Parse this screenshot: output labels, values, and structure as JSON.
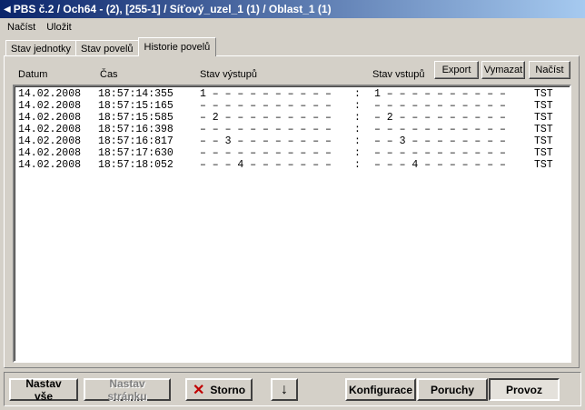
{
  "window": {
    "title": "PBS č.2 / Och64 - (2), [255-1] / Síťový_uzel_1 (1) / Oblast_1 (1)"
  },
  "menu": [
    "Načíst",
    "Uložit"
  ],
  "tabs": [
    "Stav jednotky",
    "Stav povelů",
    "Historie povelů"
  ],
  "active_tab": 2,
  "columns": {
    "date": "Datum",
    "time": "Čas",
    "outputs": "Stav výstupů",
    "inputs": "Stav vstupů"
  },
  "top_buttons": {
    "export": "Export",
    "clear": "Vymazat",
    "load": "Načíst"
  },
  "rows": [
    {
      "date": "14.02.2008",
      "time": "18:57:14:355",
      "outputs": "1 – – – – – – – – – –",
      "sep": ":",
      "inputs": "1 – – – – – – – – – –",
      "src": "TST"
    },
    {
      "date": "14.02.2008",
      "time": "18:57:15:165",
      "outputs": "– – – – – – – – – – –",
      "sep": ":",
      "inputs": "– – – – – – – – – – –",
      "src": "TST"
    },
    {
      "date": "14.02.2008",
      "time": "18:57:15:585",
      "outputs": "– 2 – – – – – – – – –",
      "sep": ":",
      "inputs": "– 2 – – – – – – – – –",
      "src": "TST"
    },
    {
      "date": "14.02.2008",
      "time": "18:57:16:398",
      "outputs": "– – – – – – – – – – –",
      "sep": ":",
      "inputs": "– – – – – – – – – – –",
      "src": "TST"
    },
    {
      "date": "14.02.2008",
      "time": "18:57:16:817",
      "outputs": "– – 3 – – – – – – – –",
      "sep": ":",
      "inputs": "– – 3 – – – – – – – –",
      "src": "TST"
    },
    {
      "date": "14.02.2008",
      "time": "18:57:17:630",
      "outputs": "– – – – – – – – – – –",
      "sep": ":",
      "inputs": "– – – – – – – – – – –",
      "src": "TST"
    },
    {
      "date": "14.02.2008",
      "time": "18:57:18:052",
      "outputs": "– – – 4 – – – – – – –",
      "sep": ":",
      "inputs": "– – – 4 – – – – – – –",
      "src": "TST"
    }
  ],
  "bottom_buttons": {
    "set_all": "Nastav vše",
    "set_page": "Nastav stránku",
    "cancel": "Storno",
    "configuration": "Konfigurace",
    "faults": "Poruchy",
    "operation": "Provoz"
  },
  "icons": {
    "cancel": "x-icon",
    "down": "down-arrow-icon",
    "title": "triangle-left-icon"
  },
  "colors": {
    "title_start": "#0a246a",
    "title_end": "#a6caf0",
    "face": "#d4d0c8",
    "cancel_icon": "#c00000"
  }
}
